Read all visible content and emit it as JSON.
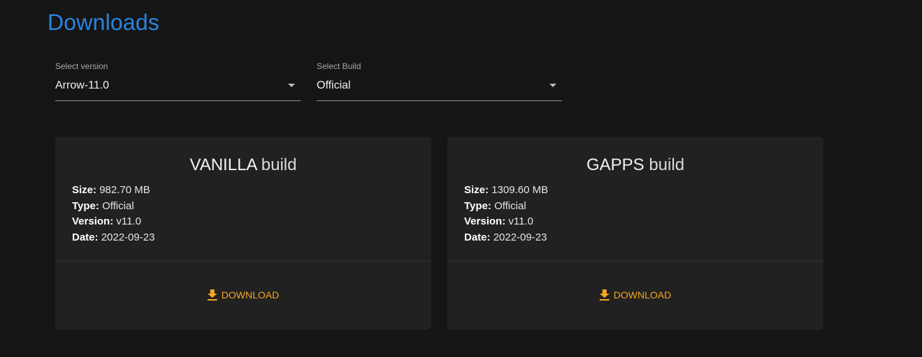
{
  "page": {
    "title": "Downloads"
  },
  "selects": {
    "version": {
      "label": "Select version",
      "value": "Arrow-11.0"
    },
    "build": {
      "label": "Select Build",
      "value": "Official"
    }
  },
  "cards": [
    {
      "variant": "VANILLA",
      "suffix": "build",
      "size_label": "Size:",
      "size": "982.70 MB",
      "type_label": "Type:",
      "type": "Official",
      "version_label": "Version:",
      "version": "v11.0",
      "date_label": "Date:",
      "date": "2022-09-23",
      "button": "DOWNLOAD"
    },
    {
      "variant": "GAPPS",
      "suffix": "build",
      "size_label": "Size:",
      "size": "1309.60 MB",
      "type_label": "Type:",
      "type": "Official",
      "version_label": "Version:",
      "version": "v11.0",
      "date_label": "Date:",
      "date": "2022-09-23",
      "button": "DOWNLOAD"
    }
  ],
  "colors": {
    "accent": "#2a84df",
    "download": "#f5a623",
    "background": "#151515",
    "card": "#212121"
  },
  "icons": {
    "select_caret": "caret-down-icon",
    "download": "download-icon"
  }
}
